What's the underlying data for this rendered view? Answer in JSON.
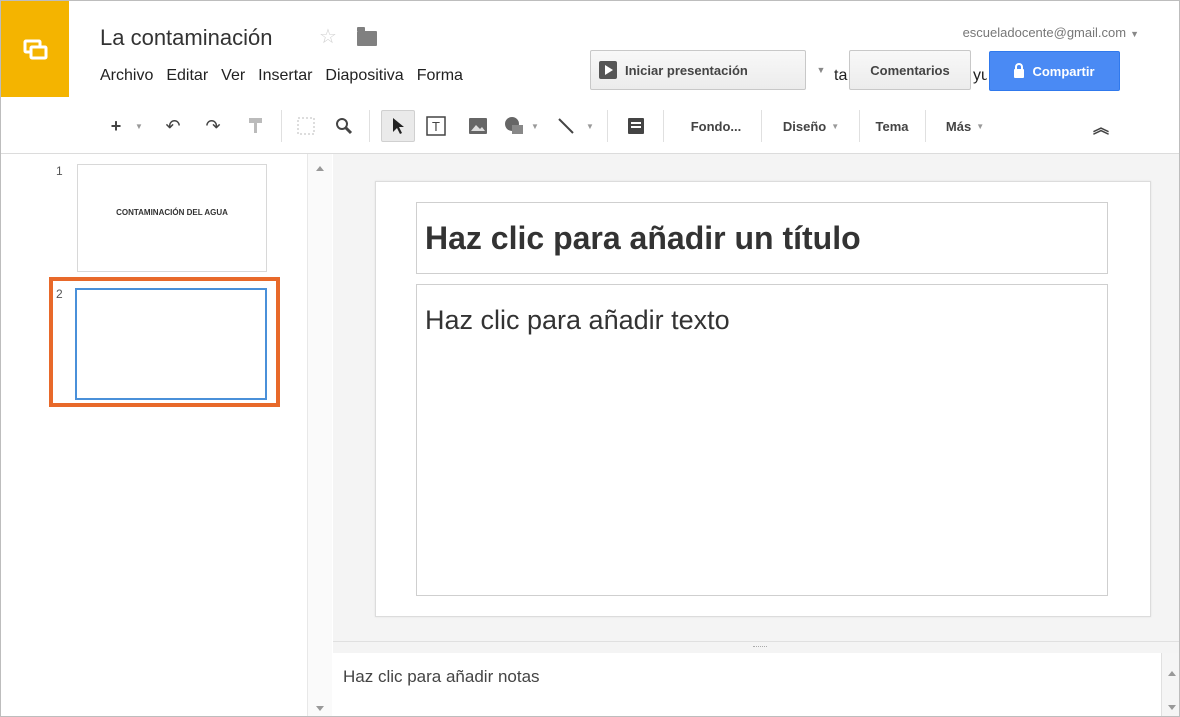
{
  "header": {
    "title": "La contaminación",
    "account": "escueladocente@gmail.com",
    "icons": {
      "logo": "slides-logo-icon",
      "star": "star-icon",
      "folder": "folder-icon"
    }
  },
  "menu": {
    "items": [
      "Archivo",
      "Editar",
      "Ver",
      "Insertar",
      "Diapositiva",
      "Forma"
    ],
    "overflow_left": "ta",
    "overflow_right": "yu"
  },
  "actions": {
    "present_label": "Iniciar presentación",
    "comments_label": "Comentarios",
    "share_label": "Compartir"
  },
  "toolbar": {
    "background_label": "Fondo...",
    "layout_label": "Diseño",
    "theme_label": "Tema",
    "more_label": "Más"
  },
  "filmstrip": {
    "slides": [
      {
        "number": "1",
        "title": "CONTAMINACIÓN DEL AGUA"
      },
      {
        "number": "2",
        "title": ""
      }
    ]
  },
  "slide": {
    "title_placeholder": "Haz clic para añadir un título",
    "body_placeholder": "Haz clic para añadir texto"
  },
  "notes": {
    "placeholder": "Haz clic para añadir notas"
  },
  "colors": {
    "logo_bg": "#f4b400",
    "share_bg": "#4a8af4",
    "highlight": "#e8692a",
    "selected_thumb": "#4a90d9"
  }
}
